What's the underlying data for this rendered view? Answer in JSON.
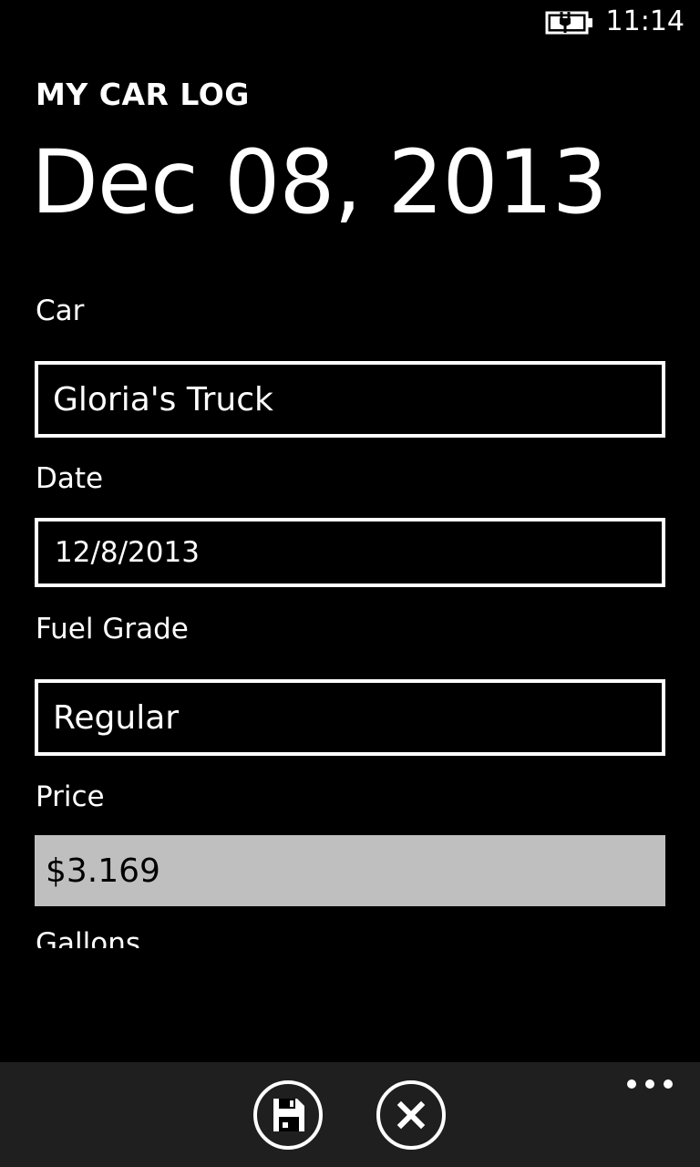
{
  "status_bar": {
    "time": "11:14",
    "battery_icon": "battery-charging-icon"
  },
  "header": {
    "app_title": "MY CAR LOG",
    "page_title": "Dec 08, 2013"
  },
  "form": {
    "car": {
      "label": "Car",
      "value": "Gloria's Truck"
    },
    "date": {
      "label": "Date",
      "value": "12/8/2013"
    },
    "fuel_grade": {
      "label": "Fuel Grade",
      "value": "Regular"
    },
    "price": {
      "label": "Price",
      "value": "$3.169"
    },
    "gallons": {
      "label": "Gallons"
    }
  },
  "app_bar": {
    "buttons": [
      {
        "icon": "save-icon"
      },
      {
        "icon": "cancel-icon"
      }
    ],
    "more_icon": "ellipsis-icon",
    "background": "#1f1f1f"
  },
  "colors": {
    "background": "#000000",
    "foreground": "#ffffff",
    "focused_field": "#bfbfbf"
  }
}
